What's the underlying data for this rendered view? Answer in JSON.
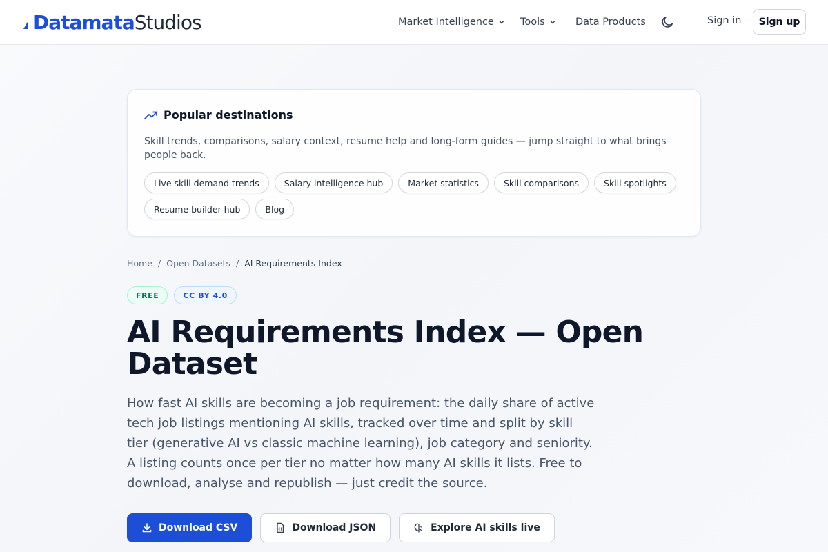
{
  "header": {
    "logo_primary": "Datamata",
    "logo_secondary": "Studios",
    "nav": [
      {
        "label": "Market Intelligence",
        "dropdown": true
      },
      {
        "label": "Tools",
        "dropdown": true
      },
      {
        "label": "Data Products",
        "dropdown": false
      }
    ],
    "theme_icon": "moon-icon",
    "sign_in": "Sign in",
    "sign_up": "Sign up"
  },
  "destinations": {
    "icon": "trending-up-icon",
    "title": "Popular destinations",
    "description": "Skill trends, comparisons, salary context, resume help and long-form guides — jump straight to what brings people back.",
    "links": [
      "Live skill demand trends",
      "Salary intelligence hub",
      "Market statistics",
      "Skill comparisons",
      "Skill spotlights",
      "Resume builder hub",
      "Blog"
    ]
  },
  "breadcrumb": {
    "items": [
      "Home",
      "Open Datasets",
      "AI Requirements Index"
    ],
    "separator": "/"
  },
  "badges": {
    "free": "FREE",
    "license": "CC BY 4.0"
  },
  "hero": {
    "title": "AI Requirements Index — Open Dataset",
    "description": "How fast AI skills are becoming a job requirement: the daily share of active tech job listings mentioning AI skills, tracked over time and split by skill tier (generative AI vs classic machine learning), job category and seniority. A listing counts once per tier no matter how many AI skills it lists. Free to download, analyse and republish — just credit the source."
  },
  "actions": {
    "download_csv": "Download CSV",
    "download_json": "Download JSON",
    "explore": "Explore AI skills live"
  },
  "colors": {
    "brand": "#1d4ed8",
    "text": "#0f172a",
    "muted": "#475569",
    "free_badge": "#047857",
    "license_badge": "#1d4ed8"
  }
}
